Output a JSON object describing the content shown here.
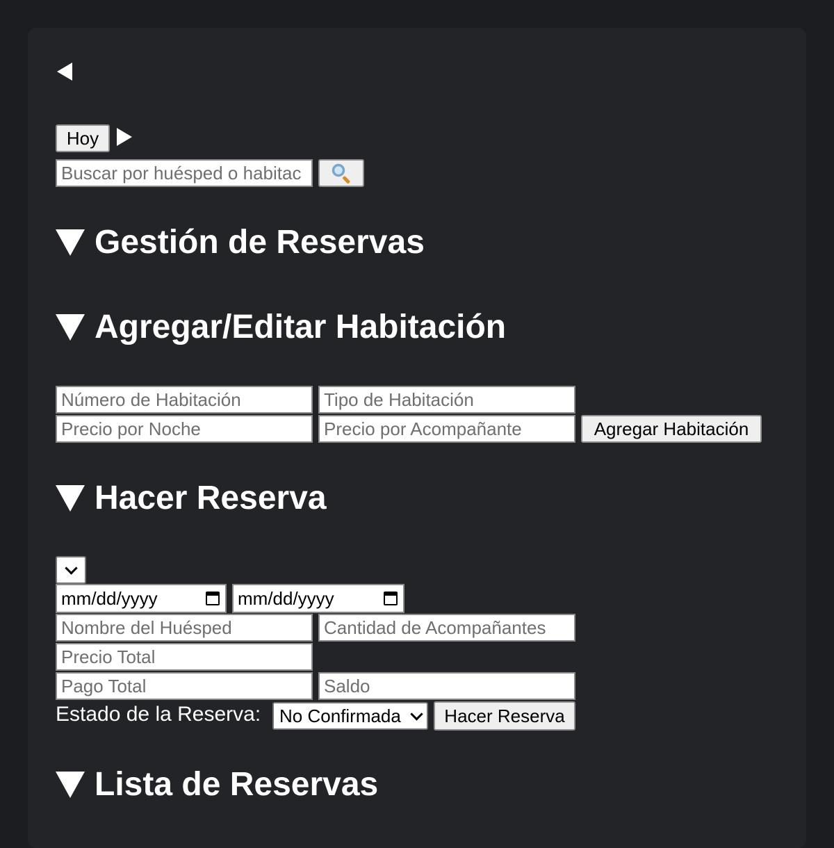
{
  "nav": {
    "today_label": "Hoy"
  },
  "search": {
    "placeholder": "Buscar por huésped o habitac"
  },
  "sections": {
    "management": "Gestión de Reservas",
    "add_room": "Agregar/Editar Habitación",
    "make_reservation": "Hacer Reserva",
    "reservation_list": "Lista de Reservas"
  },
  "room_form": {
    "room_number_placeholder": "Número de Habitación",
    "room_type_placeholder": "Tipo de Habitación",
    "price_per_night_placeholder": "Precio por Noche",
    "price_per_companion_placeholder": "Precio por Acompañante",
    "add_button": "Agregar Habitación"
  },
  "reservation_form": {
    "room_select_value": "",
    "checkin_placeholder": "mm/dd/yyyy",
    "checkout_placeholder": "mm/dd/yyyy",
    "guest_name_placeholder": "Nombre del Huésped",
    "companions_placeholder": "Cantidad de Acompañantes",
    "total_price_placeholder": "Precio Total",
    "total_payment_placeholder": "Pago Total",
    "balance_placeholder": "Saldo",
    "status_label": "Estado de la Reserva:",
    "status_value": "No Confirmada",
    "submit_button": "Hacer Reserva"
  },
  "icons": {
    "prev": "triangle-left-icon",
    "next": "triangle-right-icon",
    "search": "magnifying-glass-icon",
    "collapse": "triangle-down-icon",
    "calendar": "calendar-icon",
    "dropdown": "chevron-down-icon"
  },
  "colors": {
    "background": "#1c1d21",
    "panel": "#232428",
    "text": "#ffffff"
  }
}
